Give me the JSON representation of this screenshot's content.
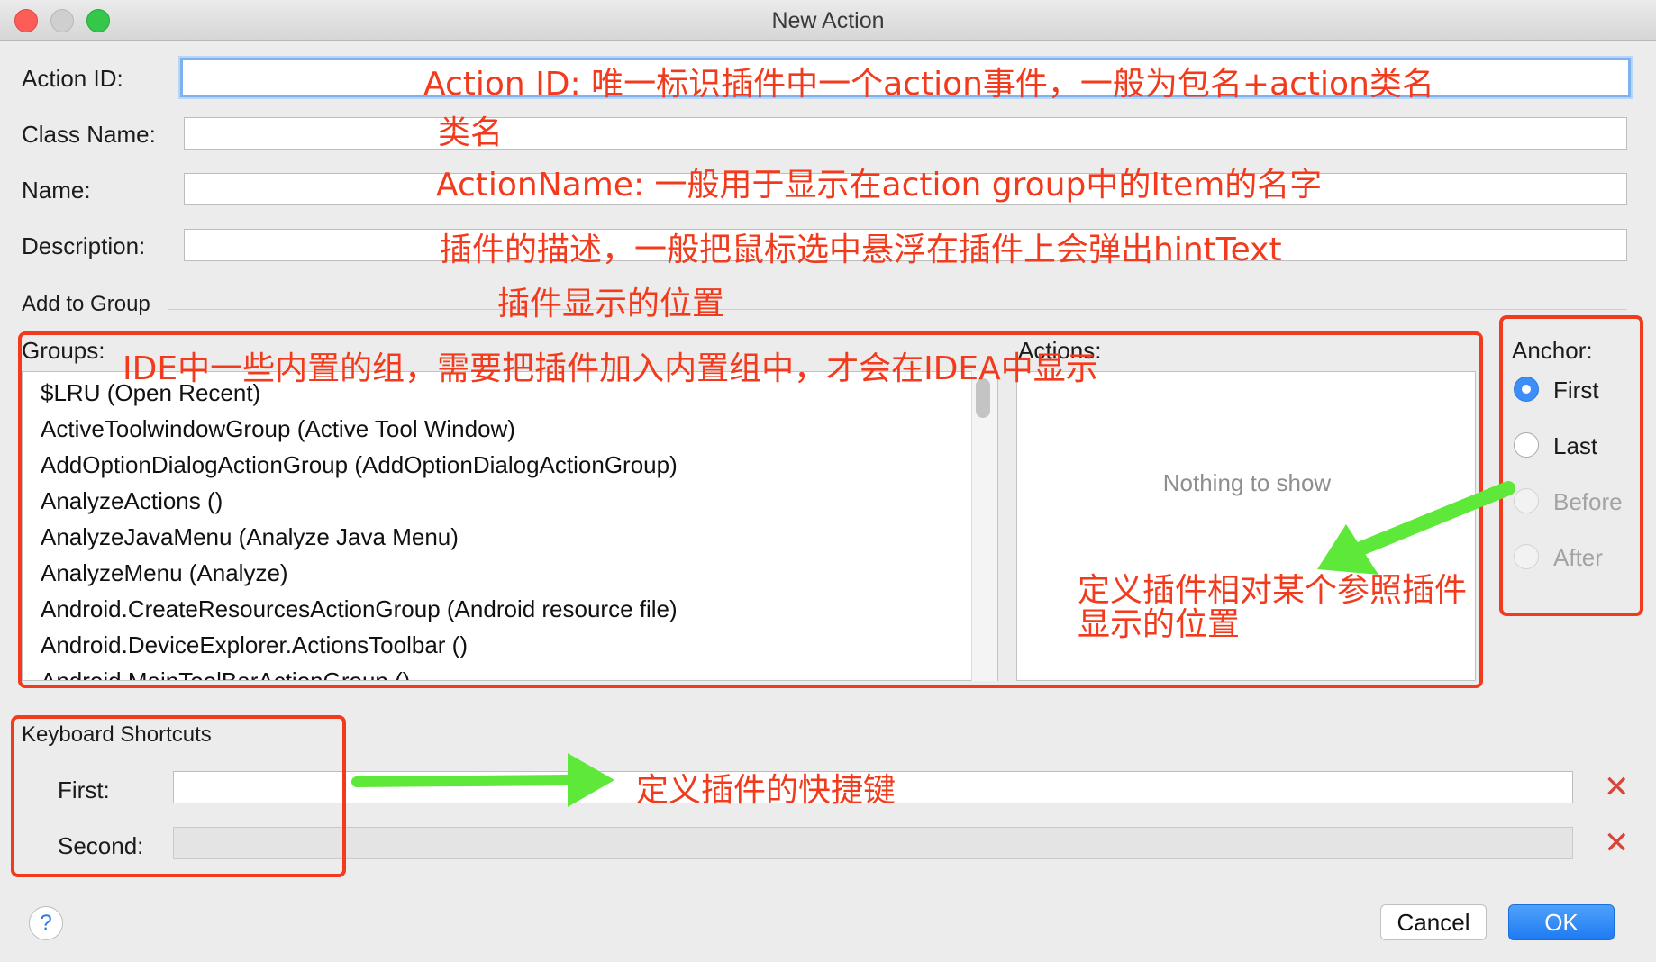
{
  "window": {
    "title": "New Action"
  },
  "form": {
    "action_id_label": "Action ID:",
    "class_name_label": "Class Name:",
    "name_label": "Name:",
    "description_label": "Description:",
    "add_to_group_label": "Add to Group",
    "action_id_value": "",
    "class_name_value": "",
    "name_value": "",
    "description_value": ""
  },
  "groups": {
    "label": "Groups:",
    "items": [
      "$LRU (Open Recent)",
      "ActiveToolwindowGroup (Active Tool Window)",
      "AddOptionDialogActionGroup (AddOptionDialogActionGroup)",
      "AnalyzeActions ()",
      "AnalyzeJavaMenu (Analyze Java Menu)",
      "AnalyzeMenu (Analyze)",
      "Android.CreateResourcesActionGroup (Android resource file)",
      "Android.DeviceExplorer.ActionsToolbar ()",
      "Android.MainToolBarActionGroup ()"
    ]
  },
  "actions": {
    "label": "Actions:",
    "empty_text": "Nothing to show"
  },
  "anchor": {
    "label": "Anchor:",
    "options": [
      {
        "label": "First",
        "selected": true,
        "enabled": true
      },
      {
        "label": "Last",
        "selected": false,
        "enabled": true
      },
      {
        "label": "Before",
        "selected": false,
        "enabled": false
      },
      {
        "label": "After",
        "selected": false,
        "enabled": false
      }
    ]
  },
  "shortcuts": {
    "label": "Keyboard Shortcuts",
    "first_label": "First:",
    "second_label": "Second:",
    "first_value": "",
    "second_value": ""
  },
  "buttons": {
    "cancel": "Cancel",
    "ok": "OK",
    "help": "?"
  },
  "annotations": {
    "action_id": "Action ID: 唯一标识插件中一个action事件，一般为包名+action类名",
    "class_name": "类名",
    "name": "ActionName: 一般用于显示在action group中的Item的名字",
    "description": "插件的描述，一般把鼠标选中悬浮在插件上会弹出hintText",
    "add_to_group": "插件显示的位置",
    "groups": "IDE中一些内置的组，需要把插件加入内置组中，才会在IDEA中显示",
    "anchor_line1": "定义插件相对某个参照插件",
    "anchor_line2": "显示的位置",
    "shortcuts": "定义插件的快捷键"
  },
  "colors": {
    "annotation": "#f23a1d",
    "arrow": "#5ee83a",
    "accent": "#3d8ef7"
  }
}
